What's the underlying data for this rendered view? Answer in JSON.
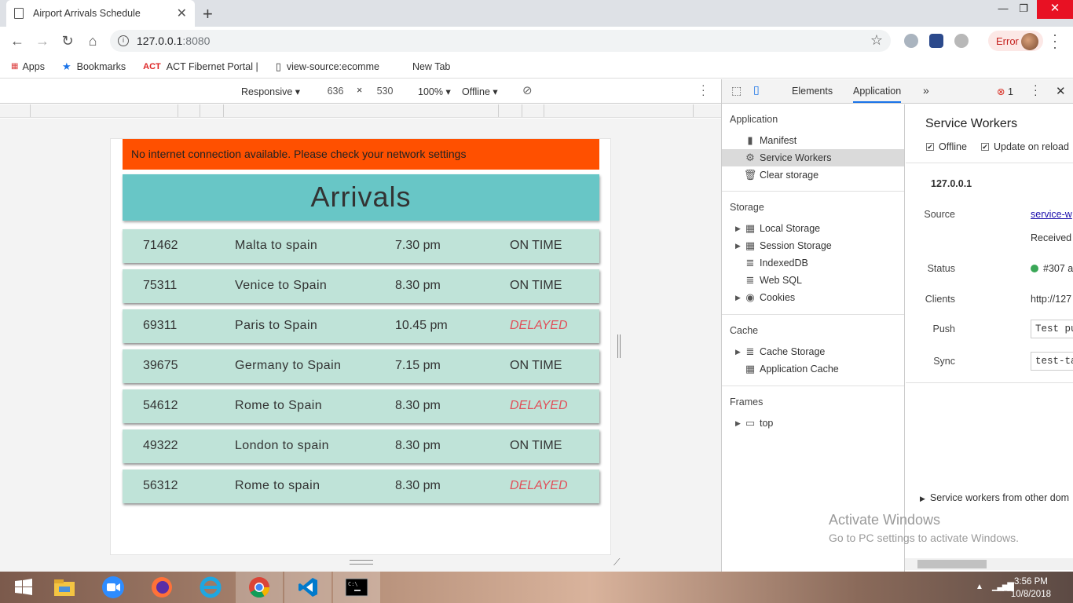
{
  "browser": {
    "tab_title": "Airport Arrivals Schedule",
    "new_tab_symbol": "+",
    "window_minimize": "—",
    "window_restore": "❐",
    "window_close": "✕",
    "url_host": "127.0.0.1",
    "url_port": ":8080",
    "error_label": "Error"
  },
  "bookmarks": [
    {
      "icon": "apps-grid-icon",
      "label": "Apps"
    },
    {
      "icon": "star-icon",
      "label": "Bookmarks"
    },
    {
      "icon": "act-logo-icon",
      "label": "ACT Fibernet Portal |"
    },
    {
      "icon": "page-icon",
      "label": "view-source:ecomme"
    },
    {
      "icon": "",
      "label": "New Tab"
    }
  ],
  "device_toolbar": {
    "device": "Responsive",
    "width": "636",
    "times": "×",
    "height": "530",
    "zoom": "100%",
    "network": "Offline"
  },
  "app": {
    "offline_message": "No internet connection available. Please check your network settings",
    "heading": "Arrivals",
    "flights": [
      {
        "number": "71462",
        "route": "Malta to spain",
        "time": "7.30 pm",
        "status": "ON TIME",
        "delayed": false
      },
      {
        "number": "75311",
        "route": "Venice to Spain",
        "time": "8.30 pm",
        "status": "ON TIME",
        "delayed": false
      },
      {
        "number": "69311",
        "route": "Paris to Spain",
        "time": "10.45 pm",
        "status": "DELAYED",
        "delayed": true
      },
      {
        "number": "39675",
        "route": "Germany to Spain",
        "time": "7.15 pm",
        "status": "ON TIME",
        "delayed": false
      },
      {
        "number": "54612",
        "route": "Rome to Spain",
        "time": "8.30 pm",
        "status": "DELAYED",
        "delayed": true
      },
      {
        "number": "49322",
        "route": "London to spain",
        "time": "8.30 pm",
        "status": "ON TIME",
        "delayed": false
      },
      {
        "number": "56312",
        "route": "Rome to spain",
        "time": "8.30 pm",
        "status": "DELAYED",
        "delayed": true
      }
    ]
  },
  "devtools": {
    "tabs": {
      "elements": "Elements",
      "application": "Application",
      "more": "»"
    },
    "error_count": "1",
    "sections": {
      "application": {
        "title": "Application",
        "items": [
          "Manifest",
          "Service Workers",
          "Clear storage"
        ]
      },
      "storage": {
        "title": "Storage",
        "items": [
          "Local Storage",
          "Session Storage",
          "IndexedDB",
          "Web SQL",
          "Cookies"
        ]
      },
      "cache": {
        "title": "Cache",
        "items": [
          "Cache Storage",
          "Application Cache"
        ]
      },
      "frames": {
        "title": "Frames",
        "items": [
          "top"
        ]
      }
    },
    "service_workers": {
      "title": "Service Workers",
      "offline_label": "Offline",
      "update_on_reload_label": "Update on reload",
      "origin": "127.0.0.1",
      "source_label": "Source",
      "source_value": "service-w",
      "received_value": "Received",
      "status_label": "Status",
      "status_value": "#307 a",
      "clients_label": "Clients",
      "clients_value": "http://127",
      "push_label": "Push",
      "push_value": "Test pu",
      "sync_label": "Sync",
      "sync_value": "test-ta",
      "other_domains": "Service workers from other dom"
    }
  },
  "watermark": {
    "line1": "Activate Windows",
    "line2": "Go to PC settings to activate Windows."
  },
  "taskbar": {
    "time": "3:56 PM",
    "date": "10/8/2018"
  },
  "colors": {
    "offline_banner": "#ff5000",
    "header": "#68c6c6",
    "row": "#bfe3d8",
    "delayed": "#e0505a"
  }
}
